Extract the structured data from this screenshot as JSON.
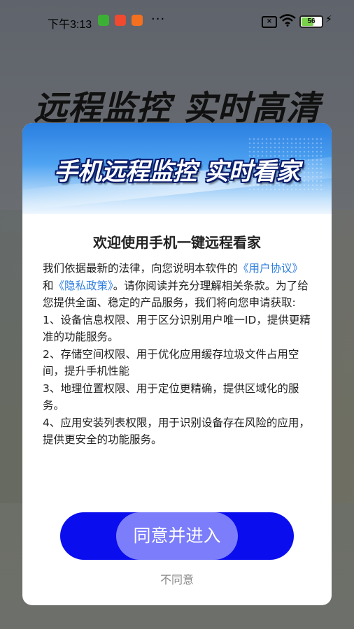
{
  "status_bar": {
    "time": "下午3:13",
    "notification_icons": [
      "wechat-icon",
      "app-icon-red",
      "taobao-icon"
    ],
    "more": "···",
    "battery": "56",
    "colors": {
      "wechat": "#3cb034",
      "app_red": "#ef4a2f",
      "taobao": "#f3701f",
      "battery_fill": "#7ad14b"
    }
  },
  "background": {
    "headline": "远程监控 实时高清"
  },
  "dialog": {
    "banner_title": "手机远程监控 实时看家",
    "title": "欢迎使用手机一键远程看家",
    "intro_prefix": "我们依据最新的法律，向您说明本软件的",
    "user_agreement_link": "《用户协议》",
    "and": "和",
    "privacy_link": "《隐私政策》",
    "intro_suffix": "。请你阅读并充分理解相关条款。为了给您提供全面、稳定的产品服务，我们将向您申请获取:",
    "items": [
      "1、设备信息权限、用于区分识别用户唯一ID，提供更精准的功能服务。",
      "2、存储空间权限、用于优化应用缓存垃圾文件占用空间，提升手机性能",
      "3、地理位置权限、用于定位更精确，提供区域化的服务。",
      "4、应用安装列表权限，用于识别设备存在风险的应用，提供更安全的功能服务。"
    ],
    "agree_button": "同意并进入",
    "disagree_button": "不同意",
    "colors": {
      "link": "#2f7fe0",
      "agree_bg": "#0a0dee",
      "agree_glow": "#7b7dfa"
    }
  }
}
